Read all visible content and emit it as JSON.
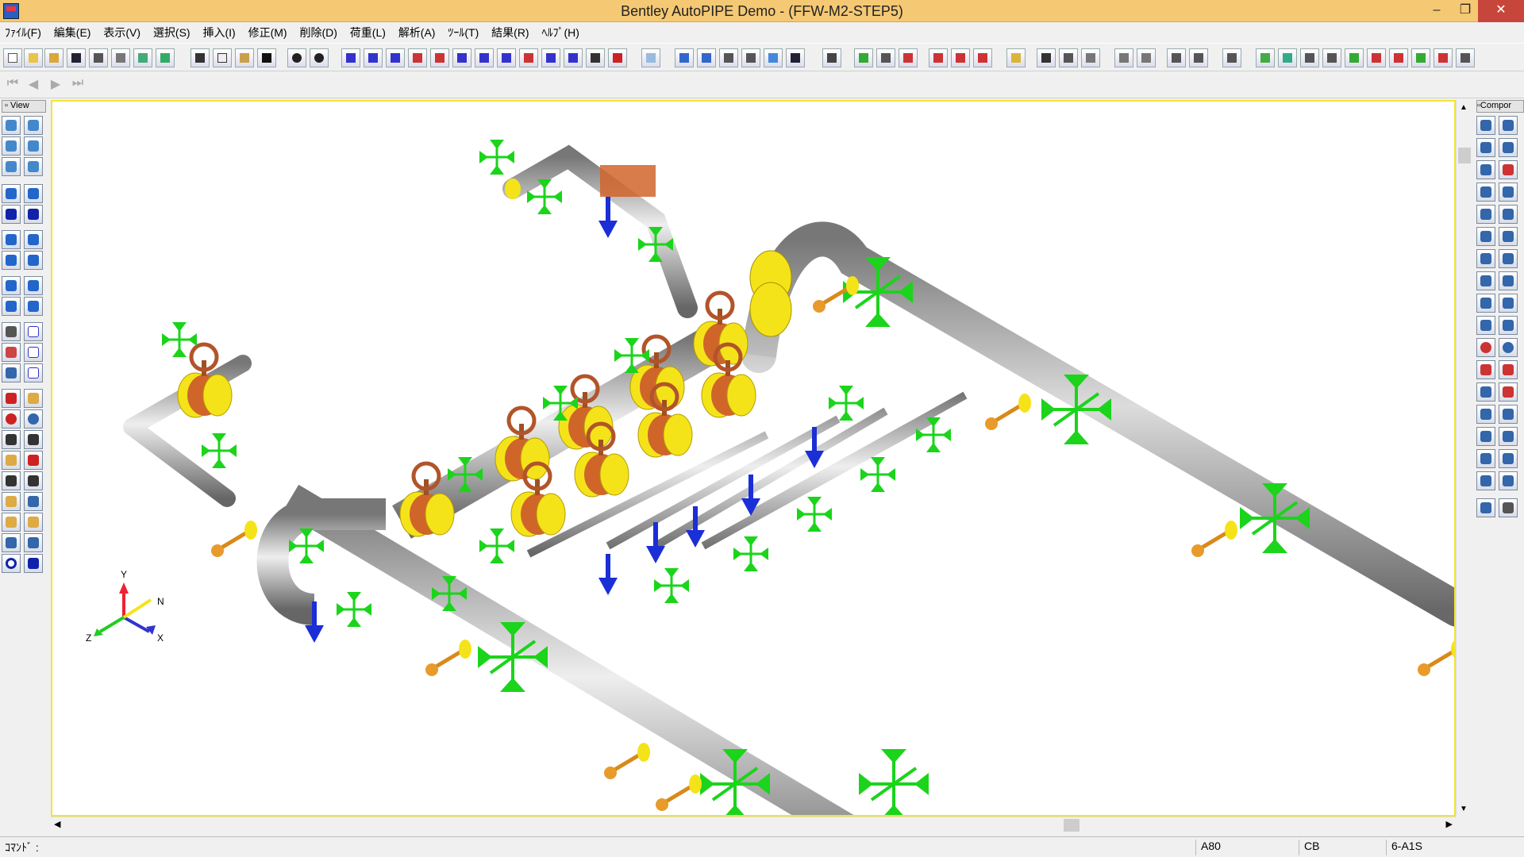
{
  "window": {
    "title": "Bentley AutoPIPE Demo - (FFW-M2-STEP5)",
    "minimize_glyph": "–",
    "restore_glyph": "❐",
    "close_glyph": "✕"
  },
  "menu": [
    "ﾌｧｲﾙ(F)",
    "編集(E)",
    "表示(V)",
    "選択(S)",
    "挿入(I)",
    "修正(M)",
    "削除(D)",
    "荷重(L)",
    "解析(A)",
    "ﾂｰﾙ(T)",
    "結果(R)",
    "ﾍﾙﾌﾟ(H)"
  ],
  "nav": {
    "first": "⏮",
    "prev": "◀",
    "next": "▶",
    "last": "⏭"
  },
  "left_palette": {
    "title": "View"
  },
  "right_palette": {
    "title": "Compor"
  },
  "axes": {
    "y": "Y",
    "n": "N",
    "x": "X",
    "z": "Z"
  },
  "scroll": {
    "up": "▲",
    "down": "▼",
    "left": "◀",
    "right": "▶"
  },
  "status": {
    "command_label": "ｺﾏﾝﾄﾞ :",
    "point": "A80",
    "component": "CB",
    "ref": "6-A1S"
  },
  "colors": {
    "pipe": "#a9a9a9",
    "flange": "#f5e31a",
    "valve": "#c8602a",
    "support": "#1bd41b",
    "anchor": "#1a2fd6"
  }
}
